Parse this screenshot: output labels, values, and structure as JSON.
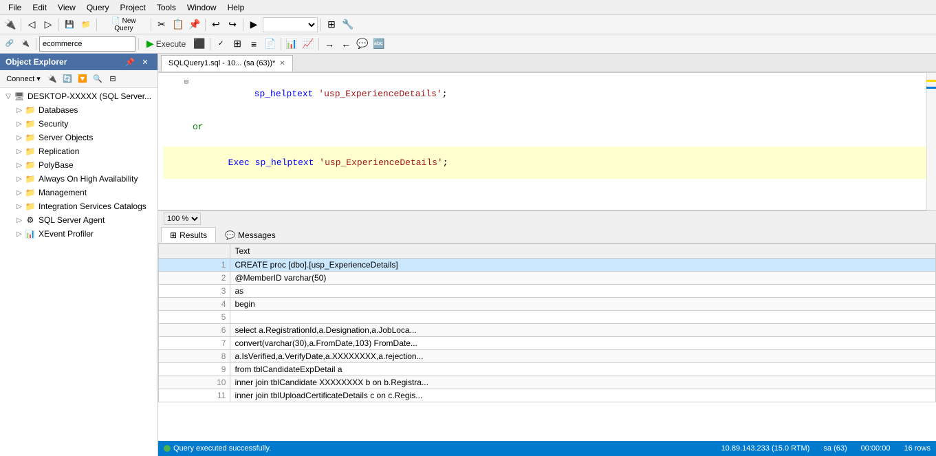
{
  "menu": {
    "items": [
      "File",
      "Edit",
      "View",
      "Query",
      "Project",
      "Tools",
      "Window",
      "Help"
    ]
  },
  "toolbar2": {
    "database_value": "ecommerce",
    "execute_label": "Execute"
  },
  "object_explorer": {
    "title": "Object Explorer",
    "connect_label": "Connect",
    "tree": [
      {
        "id": "server",
        "label": "DESKTOP-XXXXX (SQL Server...)",
        "indent": 1,
        "icon": "server",
        "expanded": true
      },
      {
        "id": "databases",
        "label": "Databases",
        "indent": 2,
        "icon": "folder",
        "expanded": false
      },
      {
        "id": "security",
        "label": "Security",
        "indent": 2,
        "icon": "folder",
        "expanded": false
      },
      {
        "id": "server-objects",
        "label": "Server Objects",
        "indent": 2,
        "icon": "folder",
        "expanded": false
      },
      {
        "id": "replication",
        "label": "Replication",
        "indent": 2,
        "icon": "folder",
        "expanded": false
      },
      {
        "id": "polybase",
        "label": "PolyBase",
        "indent": 2,
        "icon": "folder",
        "expanded": false
      },
      {
        "id": "always-on",
        "label": "Always On High Availability",
        "indent": 2,
        "icon": "folder",
        "expanded": false
      },
      {
        "id": "management",
        "label": "Management",
        "indent": 2,
        "icon": "folder",
        "expanded": false
      },
      {
        "id": "integration-services",
        "label": "Integration Services Catalogs",
        "indent": 2,
        "icon": "folder",
        "expanded": false
      },
      {
        "id": "sql-server-agent",
        "label": "SQL Server Agent",
        "indent": 2,
        "icon": "agent",
        "expanded": false
      },
      {
        "id": "xevent-profiler",
        "label": "XEvent Profiler",
        "indent": 2,
        "icon": "xevent",
        "expanded": false
      }
    ]
  },
  "tabs": [
    {
      "label": "SQLQuery1.sql - 10... (sa (63))*",
      "active": true,
      "closable": true
    }
  ],
  "sql_editor": {
    "lines": [
      {
        "num": "",
        "code": "sp_helptext 'usp_ExperienceDetails';",
        "type": "code",
        "collapse": true
      },
      {
        "num": "",
        "code": "",
        "type": "blank"
      },
      {
        "num": "",
        "code": "or",
        "type": "comment"
      },
      {
        "num": "",
        "code": "",
        "type": "blank"
      },
      {
        "num": "",
        "code": "Exec sp_helptext 'usp_ExperienceDetails';",
        "type": "highlight"
      }
    ]
  },
  "results_tabs": [
    {
      "label": "Results",
      "icon": "grid",
      "active": true
    },
    {
      "label": "Messages",
      "icon": "msg",
      "active": false
    }
  ],
  "results_grid": {
    "header": [
      "",
      "Text"
    ],
    "rows": [
      {
        "num": "1",
        "text": "CREATE proc [dbo].[usp_ExperienceDetails]",
        "selected": true
      },
      {
        "num": "2",
        "text": "@MemberID varchar(50)"
      },
      {
        "num": "3",
        "text": "as"
      },
      {
        "num": "4",
        "text": "begin"
      },
      {
        "num": "5",
        "text": ""
      },
      {
        "num": "6",
        "text": "    select a.RegistrationId,a.Designation,a.JobLoca..."
      },
      {
        "num": "7",
        "text": "    convert(varchar(30),a.FromDate,103) FromDate..."
      },
      {
        "num": "8",
        "text": "    a.IsVerified,a.VerifyDate,a.XXXXXXXX,a.rejection..."
      },
      {
        "num": "9",
        "text": "    from tblCandidateExpDetail a"
      },
      {
        "num": "10",
        "text": "    inner join tblCandidate XXXXXXXX b on b.Registra..."
      },
      {
        "num": "11",
        "text": "    inner join tblUploadCertificateDetails c on c.Regis..."
      }
    ]
  },
  "zoom": {
    "level": "100 %"
  },
  "status": {
    "message": "Query executed successfully.",
    "server": "10.89.143.233 (15.0 RTM)",
    "user": "sa (63)",
    "time": "00:00:00",
    "rows": "16 rows"
  }
}
